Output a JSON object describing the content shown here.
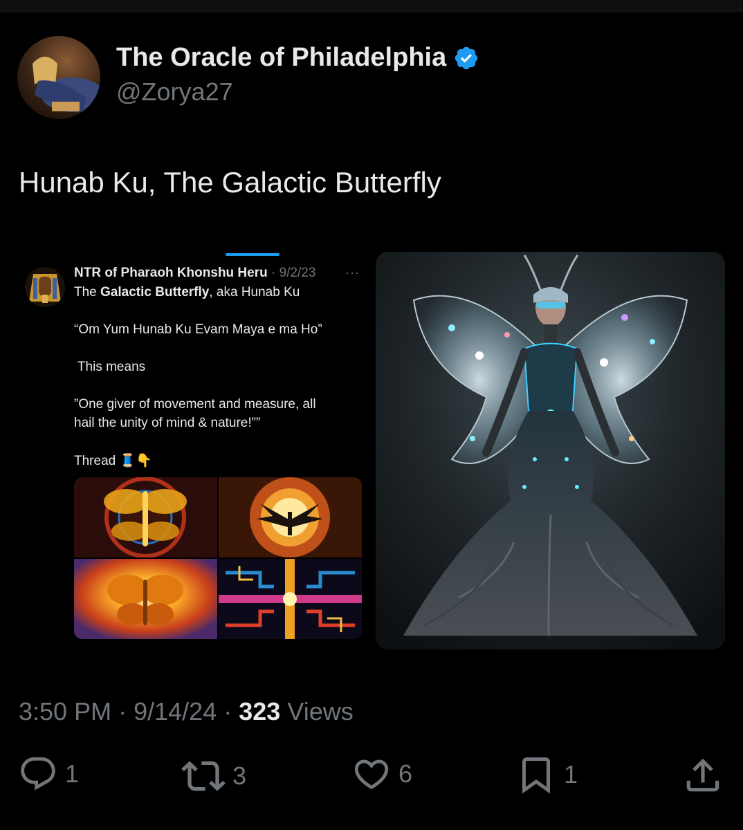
{
  "author": {
    "display_name": "The Oracle of Philadelphia",
    "handle": "@Zorya27",
    "verified": true
  },
  "tweet": {
    "text": "Hunab Ku, The Galactic Butterfly",
    "time": "3:50 PM",
    "date": "9/14/24",
    "views_count": "323",
    "views_label": "Views",
    "separator": "·"
  },
  "embedded_post": {
    "author": "NTR of Pharaoh Khonshu Heru",
    "date": "· 9/2/23",
    "more": "···",
    "line1_prefix": "The ",
    "line1_bold": "Galactic Butterfly",
    "line1_suffix": ", aka Hunab Ku",
    "line2": "“Om Yum Hunab Ku Evam Maya e ma Ho”",
    "line3": " This means",
    "line4": "”One giver of movement and measure, all",
    "line5": "hail the unity of mind & nature!””",
    "line6": "Thread 🧵👇"
  },
  "actions": {
    "replies": "1",
    "reposts": "3",
    "likes": "6",
    "bookmarks": "1"
  },
  "colors": {
    "background": "#000000",
    "text_primary": "#e7e9ea",
    "text_secondary": "#71767b",
    "verified_blue": "#1d9bf0"
  },
  "icons": [
    "verified-badge-icon",
    "reply-icon",
    "repost-icon",
    "like-icon",
    "bookmark-icon",
    "share-icon"
  ]
}
